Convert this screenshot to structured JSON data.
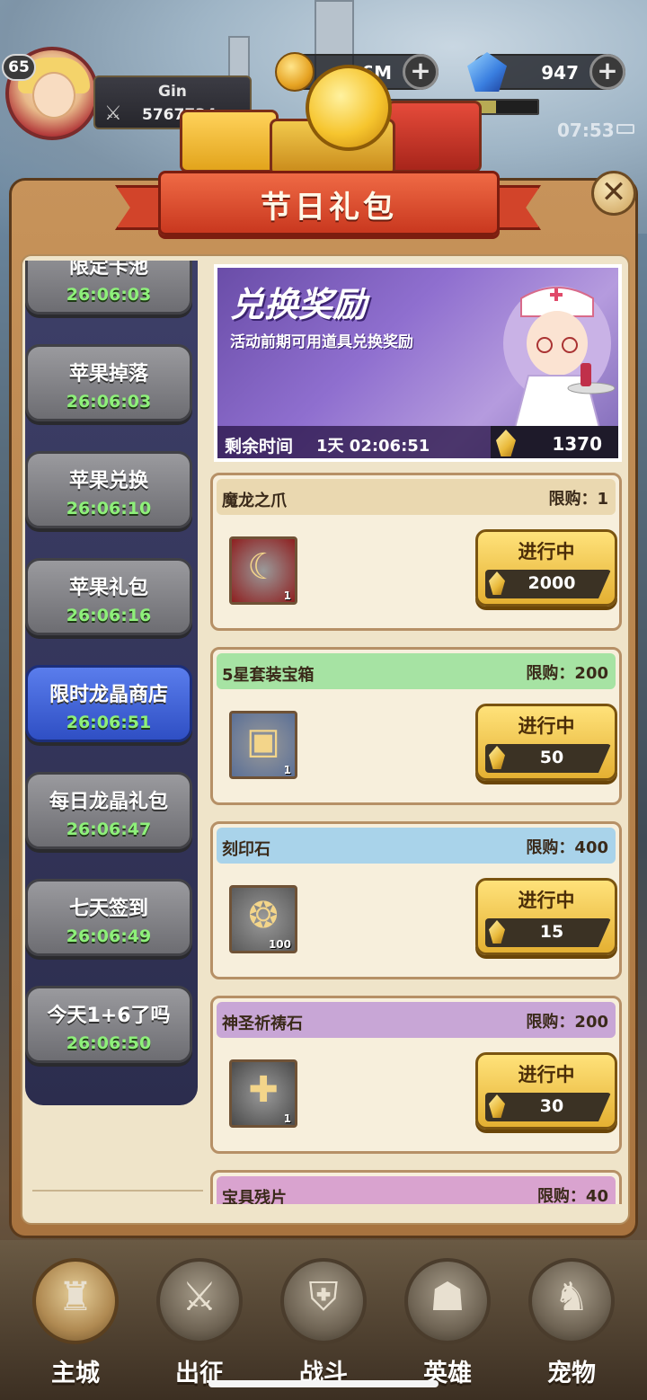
{
  "status": {
    "level": "65",
    "player_name": "Gin",
    "power": "5767734",
    "gold": "6.6M",
    "gems": "947",
    "clock": "07:53",
    "xp_progress": 0.72
  },
  "panel": {
    "title": "节日礼包",
    "close_icon": "close-icon"
  },
  "tabs": [
    {
      "label": "限定卡池",
      "time": "26:06:03",
      "active": false
    },
    {
      "label": "苹果掉落",
      "time": "26:06:03",
      "active": false
    },
    {
      "label": "苹果兑换",
      "time": "26:06:10",
      "active": false
    },
    {
      "label": "苹果礼包",
      "time": "26:06:16",
      "active": false
    },
    {
      "label": "限时龙晶商店",
      "time": "26:06:51",
      "active": true
    },
    {
      "label": "每日龙晶礼包",
      "time": "26:06:47",
      "active": false
    },
    {
      "label": "七天签到",
      "time": "26:06:49",
      "active": false
    },
    {
      "label": "今天1+6了吗",
      "time": "26:06:50",
      "active": false
    }
  ],
  "banner": {
    "title": "兑换奖励",
    "subtitle": "活动前期可用道具兑换奖励",
    "remaining_label": "剩余时间",
    "remaining_time": "1天 02:06:51",
    "currency_count": "1370"
  },
  "shop_items": [
    {
      "name": "魔龙之爪",
      "limit": "限购：1",
      "qty": "1",
      "button": "进行中",
      "price": "2000",
      "header_color": "#ead8b0",
      "icon": "dragon-claw-icon"
    },
    {
      "name": "5星套装宝箱",
      "limit": "限购：200",
      "qty": "1",
      "button": "进行中",
      "price": "50",
      "header_color": "#a6e3a3",
      "icon": "treasure-chest-icon"
    },
    {
      "name": "刻印石",
      "limit": "限购：400",
      "qty": "100",
      "button": "进行中",
      "price": "15",
      "header_color": "#a9d3ea",
      "icon": "engraving-stone-icon"
    },
    {
      "name": "神圣祈祷石",
      "limit": "限购：200",
      "qty": "1",
      "button": "进行中",
      "price": "30",
      "header_color": "#c8a6d6",
      "icon": "prayer-stone-icon"
    },
    {
      "name": "宝具残片",
      "limit": "限购：40",
      "qty": "",
      "button": "",
      "price": "",
      "header_color": "#d9a3cf",
      "icon": "relic-shard-icon"
    }
  ],
  "bottom_nav": [
    {
      "label": "主城",
      "icon": "castle-tower-icon"
    },
    {
      "label": "出征",
      "icon": "crossed-swords-icon"
    },
    {
      "label": "战斗",
      "icon": "battle-shield-icon"
    },
    {
      "label": "英雄",
      "icon": "hooded-hero-icon"
    },
    {
      "label": "宠物",
      "icon": "pet-dragon-icon"
    }
  ]
}
